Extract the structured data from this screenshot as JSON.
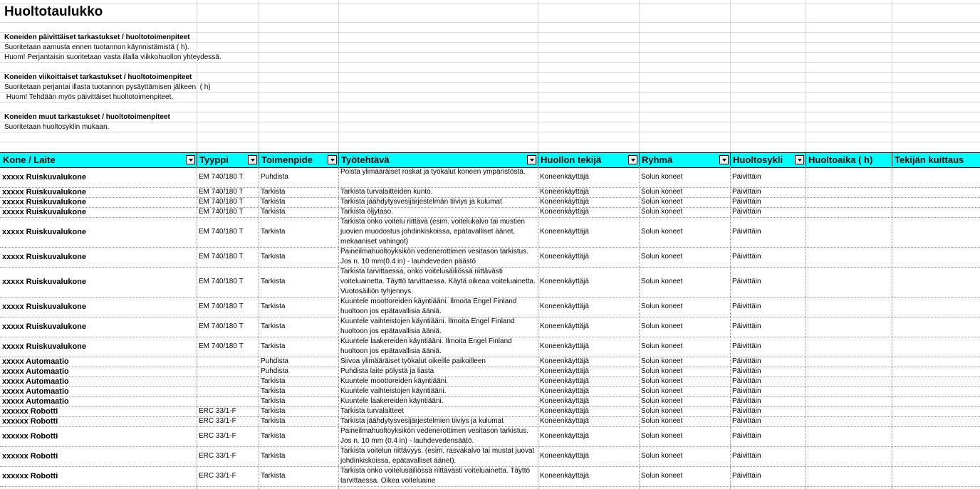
{
  "title": "Huoltotaulukko",
  "sections": [
    {
      "heading": "Koneiden päivittäiset tarkastukset / huoltotoimenpiteet",
      "lines": [
        "Suoritetaan aamusta ennen tuotannon käynnistämistä (  h).",
        "Huom! Perjantaisin suoritetaan vasta illalla viikkohuollon yhteydessä."
      ]
    },
    {
      "heading": "Koneiden viikoittaiset tarkastukset / huoltotoimenpiteet",
      "lines": [
        "Suoritetaan perjantai illasta tuotannon pysäyttämisen jälkeen. (  h)",
        " Huom! Tehdään myös päivittäiset huoltotoimenpiteet."
      ]
    },
    {
      "heading": "Koneiden muut tarkastukset / huoltotoimenpiteet",
      "lines": [
        "Suoritetaan huoltosyklin mukaan."
      ]
    }
  ],
  "header_color": "#00ffff",
  "columns": [
    "Kone / Laite",
    "Tyyppi",
    "Toimenpide",
    "Työtehtävä",
    "Huollon tekijä",
    "Ryhmä",
    "Huoltosykli",
    "Huoltoaika (  h)",
    "Tekijän kuittaus"
  ],
  "rows": [
    {
      "machine": "xxxxx   Ruiskuvalukone",
      "type": "EM 740/180 T",
      "action": "Puhdista",
      "task": "Poista ylimääräiset roskat ja työkalut koneen ympäristöstä.",
      "worker": "Koneenkäyttäjä",
      "group": "Solun koneet",
      "cycle": "Päivittäin"
    },
    {
      "machine": "xxxxx   Ruiskuvalukone",
      "type": "EM 740/180 T",
      "action": "Tarkista",
      "task": "Tarkista turvalaitteiden kunto.",
      "worker": "Koneenkäyttäjä",
      "group": "Solun koneet",
      "cycle": "Päivittäin"
    },
    {
      "machine": "xxxxx   Ruiskuvalukone",
      "type": "EM 740/180 T",
      "action": "Tarkista",
      "task": "Tarkista jäähdytysvesijärjestelmän tiiviys ja kulumat",
      "worker": "Koneenkäyttäjä",
      "group": "Solun koneet",
      "cycle": "Päivittäin"
    },
    {
      "machine": "xxxxx   Ruiskuvalukone",
      "type": "EM 740/180 T",
      "action": "Tarkista",
      "task": "Tarkista öljytaso.",
      "worker": "Koneenkäyttäjä",
      "group": "Solun koneet",
      "cycle": "Päivittäin"
    },
    {
      "machine": "xxxxx   Ruiskuvalukone",
      "type": "EM 740/180 T",
      "action": "Tarkista",
      "task": "Tarkista onko voitelu riittävä (esim. voitelukalvo tai mustien juovien muodostus johdinkiskoissa, epätavalliset äänet, mekaaniset vahingot)",
      "worker": "Koneenkäyttäjä",
      "group": "Solun koneet",
      "cycle": "Päivittäin"
    },
    {
      "machine": "xxxxx   Ruiskuvalukone",
      "type": "EM 740/180 T",
      "action": "Tarkista",
      "task": "Paineilmahuoltoyksikön vedenerottimen vesitason tarkistus. Jos n. 10 mm(0.4 in) - lauhdeveden päästö",
      "worker": "Koneenkäyttäjä",
      "group": "Solun koneet",
      "cycle": "Päivittäin"
    },
    {
      "machine": "xxxxx   Ruiskuvalukone",
      "type": "EM 740/180 T",
      "action": "Tarkista",
      "task": "Tarkista tarvittaessa, onko voitelusäiliössä riittävästi voiteluainetta. Täyttö tarvittaessa. Käytä oikeaa voiteluainetta. Vuotosäiliön tyhjennys.",
      "worker": "Koneenkäyttäjä",
      "group": "Solun koneet",
      "cycle": "Päivittäin"
    },
    {
      "machine": "xxxxx   Ruiskuvalukone",
      "type": "EM 740/180 T",
      "action": "Tarkista",
      "task": "Kuuntele moottoreiden käyntiääni. Ilmoita Engel Finland huoltoon jos epätavallisia ääniä.",
      "worker": "Koneenkäyttäjä",
      "group": "Solun koneet",
      "cycle": "Päivittäin"
    },
    {
      "machine": "xxxxx   Ruiskuvalukone",
      "type": "EM 740/180 T",
      "action": "Tarkista",
      "task": "Kuuntele vaihteistojen käyntiääni. Ilmoita Engel Finland huoltoon jos epätavallisia ääniä.",
      "worker": "Koneenkäyttäjä",
      "group": "Solun koneet",
      "cycle": "Päivittäin"
    },
    {
      "machine": "xxxxx   Ruiskuvalukone",
      "type": "EM 740/180 T",
      "action": "Tarkista",
      "task": "Kuuntele laakereiden käyntiääni. Ilmoita Engel Finland huoltoon jos epätavallisia ääniä.",
      "worker": "Koneenkäyttäjä",
      "group": "Solun koneet",
      "cycle": "Päivittäin"
    },
    {
      "machine": "xxxxx  Automaatio",
      "type": "",
      "action": "Puhdista",
      "task": "Siivoa ylimääräiset työkalut oikeille paikoilleen",
      "worker": "Koneenkäyttäjä",
      "group": "Solun koneet",
      "cycle": "Päivittäin"
    },
    {
      "machine": "xxxxx  Automaatio",
      "type": "",
      "action": "Puhdista",
      "task": "Puhdista laite pölystä ja liasta",
      "worker": "Koneenkäyttäjä",
      "group": "Solun koneet",
      "cycle": "Päivittäin"
    },
    {
      "machine": "xxxxx  Automaatio",
      "type": "",
      "action": "Tarkista",
      "task": "Kuuntele moottoreiden käyntiääni.",
      "worker": "Koneenkäyttäjä",
      "group": "Solun koneet",
      "cycle": "Päivittäin"
    },
    {
      "machine": "xxxxx  Automaatio",
      "type": "",
      "action": "Tarkista",
      "task": "Kuuntele vaihteistojen käyntiääni.",
      "worker": "Koneenkäyttäjä",
      "group": "Solun koneet",
      "cycle": "Päivittäin"
    },
    {
      "machine": "xxxxx  Automaatio",
      "type": "",
      "action": "Tarkista",
      "task": "Kuuntele laakereiden käyntiääni.",
      "worker": "Koneenkäyttäjä",
      "group": "Solun koneet",
      "cycle": "Päivittäin"
    },
    {
      "machine": "xxxxxx  Robotti",
      "type": "ERC 33/1-F",
      "action": "Tarkista",
      "task": "Tarkista turvalaitteet",
      "worker": "Koneenkäyttäjä",
      "group": "Solun koneet",
      "cycle": "Päivittäin"
    },
    {
      "machine": "xxxxxx  Robotti",
      "type": "ERC 33/1-F",
      "action": "Tarkista",
      "task": "Tarkista jäähdytysvesijärjestelmien tiiviys ja kulumat",
      "worker": "Koneenkäyttäjä",
      "group": "Solun koneet",
      "cycle": "Päivittäin"
    },
    {
      "machine": "xxxxxx  Robotti",
      "type": "ERC 33/1-F",
      "action": "Tarkista",
      "task": "Paineilmahuoltoyksikön vedenerottimen vesitason tarkistus. Jos n. 10 mm (0.4 in) - lauhdevedensäätö.",
      "worker": "Koneenkäyttäjä",
      "group": "Solun koneet",
      "cycle": "Päivittäin"
    },
    {
      "machine": "xxxxxx  Robotti",
      "type": "ERC 33/1-F",
      "action": "Tarkista",
      "task": "Tarkista voitelun riittävyys. (esim. rasvakalvo tai mustat juovat johdinkiskoissa, epätavalliset äänet).",
      "worker": "Koneenkäyttäjä",
      "group": "Solun koneet",
      "cycle": "Päivittäin"
    },
    {
      "machine": "xxxxxx  Robotti",
      "type": "ERC 33/1-F",
      "action": "Tarkista",
      "task": "Tarkista onko voitelusäiliössä riittävästi voiteluainetta. Täyttö tarvittaessa. Oikea voiteluaine",
      "worker": "Koneenkäyttäjä",
      "group": "Solun koneet",
      "cycle": "Päivittäin"
    }
  ]
}
